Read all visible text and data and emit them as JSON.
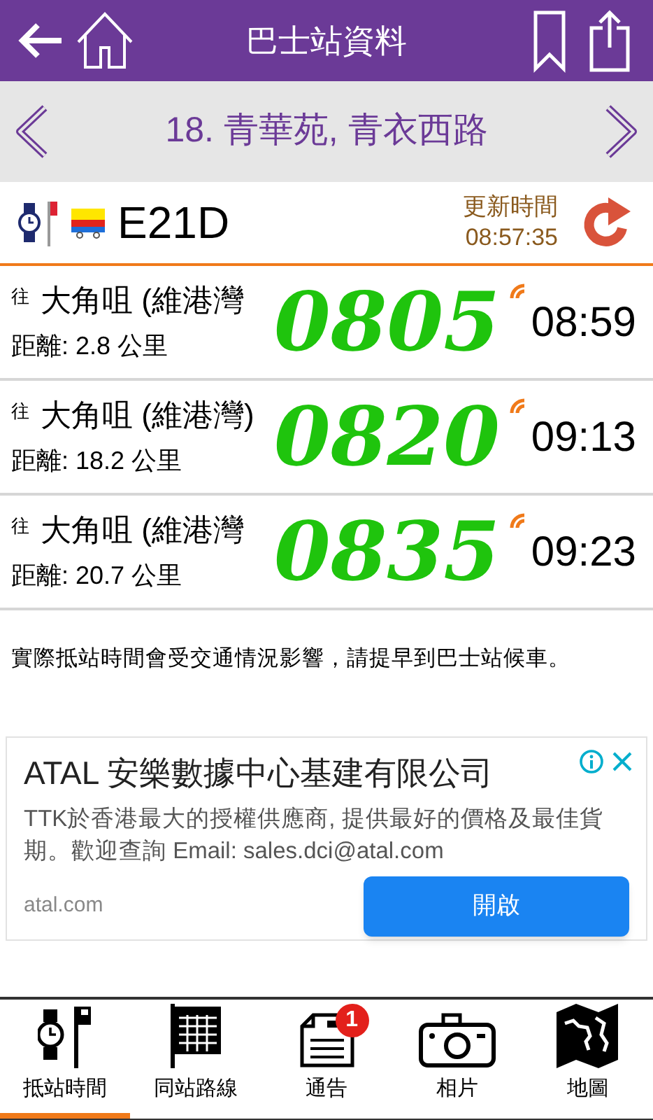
{
  "header": {
    "title": "巴士站資料"
  },
  "stop": {
    "name": "18. 青華苑, 青衣西路"
  },
  "route": {
    "number": "E21D",
    "updated_label": "更新時間",
    "updated_time": "08:57:35"
  },
  "arrivals": [
    {
      "prefix": "往",
      "destination": "大角咀 (維港灣",
      "distance": "距離: 2.8 公里",
      "time": "08:59",
      "live": true
    },
    {
      "prefix": "往",
      "destination": "大角咀 (維港灣)",
      "distance": "距離: 18.2 公里",
      "time": "09:13",
      "live": true
    },
    {
      "prefix": "往",
      "destination": "大角咀 (維港灣",
      "distance": "距離: 20.7 公里",
      "time": "09:23",
      "live": true
    }
  ],
  "handwritten_notes": [
    "0805",
    "0820",
    "0835"
  ],
  "notice": "實際抵站時間會受交通情況影響，請提早到巴士站候車。",
  "ad": {
    "title": "ATAL 安樂數據中心基建有限公司",
    "body": "TTK於香港最大的授權供應商, 提供最好的價格及最佳貨期。歡迎查詢 Email: sales.dci@atal.com",
    "domain": "atal.com",
    "button": "開啟"
  },
  "tabs": [
    {
      "kind": "eta",
      "label": "抵站時間",
      "selected": true
    },
    {
      "kind": "routes",
      "label": "同站路線",
      "selected": false
    },
    {
      "kind": "notice",
      "label": "通告",
      "selected": false,
      "badge": "1"
    },
    {
      "kind": "photos",
      "label": "相片",
      "selected": false
    },
    {
      "kind": "map",
      "label": "地圖",
      "selected": false
    }
  ]
}
